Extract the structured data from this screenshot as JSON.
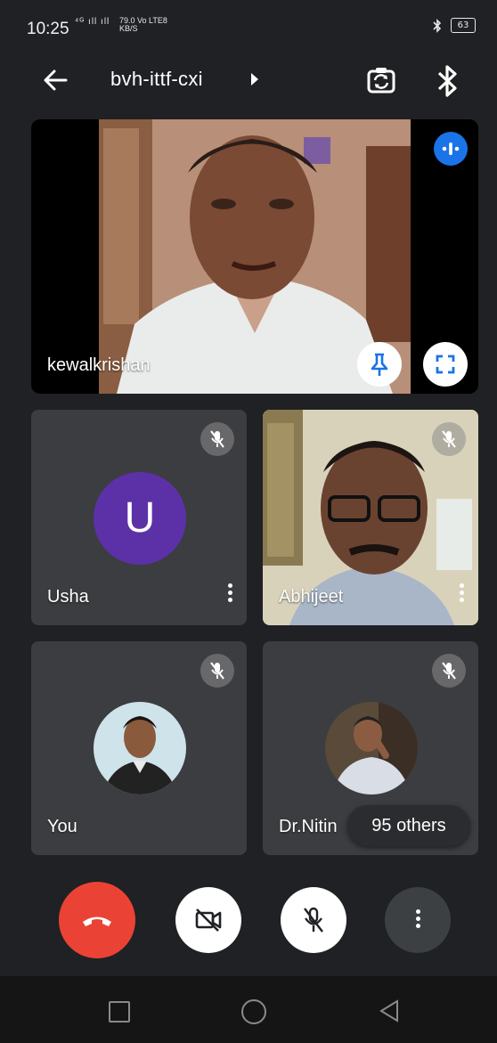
{
  "status_bar": {
    "time": "10:25",
    "network": "⁴ᴳ ıll ıll",
    "speed_value": "79.0",
    "speed_unit": "KB/S",
    "volte": "Vo LTE8",
    "battery": "63"
  },
  "app_bar": {
    "meeting_code": "bvh-ittf-cxi",
    "icons": [
      "back-arrow-icon",
      "switch-camera-icon",
      "bluetooth-icon"
    ]
  },
  "main_tile": {
    "name": "kewalkrishan",
    "speaking": true,
    "icons": [
      "audio-level-icon",
      "pin-icon",
      "fullscreen-icon"
    ]
  },
  "tiles": [
    {
      "name": "Usha",
      "avatar_letter": "U",
      "avatar_color": "#5c31a8",
      "muted": true
    },
    {
      "name": "Abhijeet",
      "muted": true
    },
    {
      "name": "You",
      "muted": true
    },
    {
      "name": "Dr.Nitin",
      "muted": true
    }
  ],
  "others_count_label": "95 others",
  "controls": [
    "end-call-button",
    "camera-off-button",
    "mic-off-button",
    "more-options-button"
  ],
  "colors": {
    "end_call": "#ea4335",
    "avatar_u": "#5c31a8",
    "speaking_badge": "#1a73e8",
    "pin_icon": "#1a73e8"
  }
}
